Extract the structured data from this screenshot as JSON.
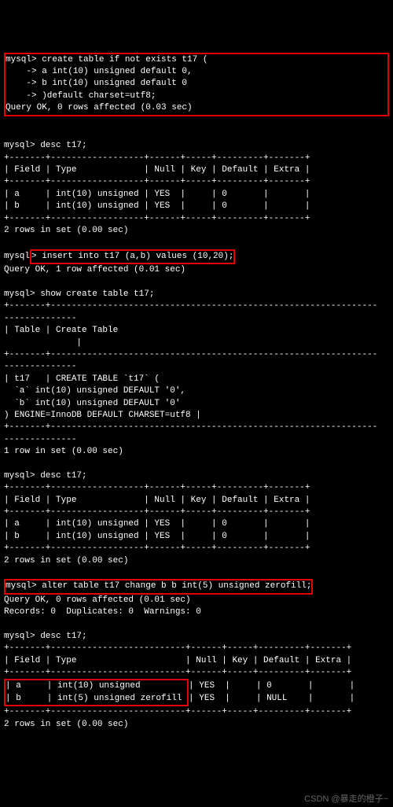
{
  "block1": {
    "l1": "mysql> create table if not exists t17 (",
    "l2": "    -> a int(10) unsigned default 0,",
    "l3": "    -> b int(10) unsigned default 0",
    "l4": "    -> )default charset=utf8;",
    "l5": "Query OK, 0 rows affected (0.03 sec)"
  },
  "desc1": {
    "cmd": "mysql> desc t17;",
    "sep": "+-------+------------------+------+-----+---------+-------+",
    "hdr": "| Field | Type             | Null | Key | Default | Extra |",
    "r1": "| a     | int(10) unsigned | YES  |     | 0       |       |",
    "r2": "| b     | int(10) unsigned | YES  |     | 0       |       |",
    "foot": "2 rows in set (0.00 sec)"
  },
  "insert": {
    "pfx": "mysql",
    "cmd": "> insert into t17 (a,b) values (10,20);",
    "res": "Query OK, 1 row affected (0.01 sec)"
  },
  "showcreate": {
    "cmd": "mysql> show create table t17;",
    "dash": "+-------+---------------------------------------------------------------",
    "dash2": "--------------",
    "hdr1": "| Table | Create Table",
    "hdr2": "              |",
    "r1": "| t17   | CREATE TABLE `t17` (",
    "r2": "  `a` int(10) unsigned DEFAULT '0',",
    "r3": "  `b` int(10) unsigned DEFAULT '0'",
    "r4": ") ENGINE=InnoDB DEFAULT CHARSET=utf8 |",
    "foot": "1 row in set (0.00 sec)"
  },
  "desc2": {
    "cmd": "mysql> desc t17;",
    "sep": "+-------+------------------+------+-----+---------+-------+",
    "hdr": "| Field | Type             | Null | Key | Default | Extra |",
    "r1": "| a     | int(10) unsigned | YES  |     | 0       |       |",
    "r2": "| b     | int(10) unsigned | YES  |     | 0       |       |",
    "foot": "2 rows in set (0.00 sec)"
  },
  "alter": {
    "cmd": "mysql> alter table t17 change b b int(5) unsigned zerofill;",
    "res": "Query OK, 0 rows affected (0.01 sec)",
    "rec": "Records: 0  Duplicates: 0  Warnings: 0"
  },
  "desc3": {
    "cmd": "mysql> desc t17;",
    "sep": "+-------+--------------------------+------+-----+---------+-------+",
    "hdr": "| Field | Type                     | Null | Key | Default | Extra |",
    "r1l": "| a     | int(10) unsigned         ",
    "r1r": "| YES  |     | 0       |       |",
    "r2l": "| b     | int(5) unsigned zerofill ",
    "r2r": "| YES  |     | NULL    |       |",
    "foot": "2 rows in set (0.00 sec)"
  },
  "watermark": "CSDN @暴走的橙子~"
}
